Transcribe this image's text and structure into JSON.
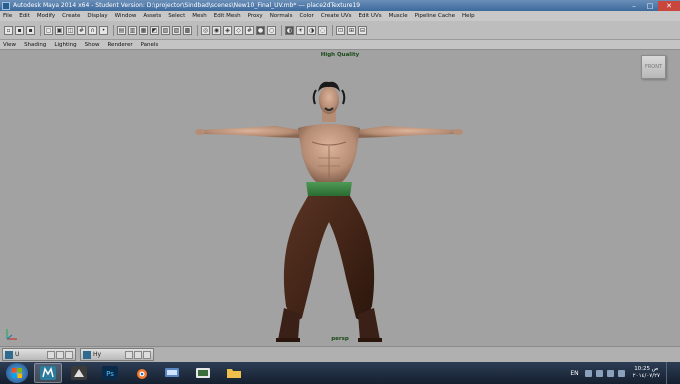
{
  "window": {
    "title": "Autodesk Maya 2014 x64 - Student Version: D:\\projector\\Sindbad\\scenes\\New10_Final_UV.mb*   ---   place2dTexture19",
    "min": "–",
    "max": "□",
    "close": "✕"
  },
  "menubar": {
    "items": [
      "File",
      "Edit",
      "Modify",
      "Create",
      "Display",
      "Window",
      "Assets",
      "Select",
      "Mesh",
      "Edit Mesh",
      "Proxy",
      "Normals",
      "Color",
      "Create UVs",
      "Edit UVs",
      "Muscle",
      "Pipeline Cache",
      "Help"
    ]
  },
  "panel_menu": {
    "items": [
      "View",
      "Shading",
      "Lighting",
      "Show",
      "Renderer",
      "Panels"
    ]
  },
  "viewport": {
    "quality_label": "High Quality",
    "camera_label": "persp",
    "viewcube_label": "FRONT"
  },
  "minimized_windows": [
    {
      "label": "U",
      "icon": "maya-window-icon"
    },
    {
      "label": "Hy",
      "icon": "hypershade-icon"
    }
  ],
  "taskbar": {
    "apps": [
      {
        "name": "start-button",
        "icon": "windows-logo-icon"
      },
      {
        "name": "maya",
        "icon": "maya-icon",
        "active": true
      },
      {
        "name": "mudbox",
        "icon": "mudbox-icon"
      },
      {
        "name": "photoshop",
        "icon": "photoshop-icon",
        "label": "Ps"
      },
      {
        "name": "blender",
        "icon": "blender-icon"
      },
      {
        "name": "network",
        "icon": "network-icon"
      },
      {
        "name": "media",
        "icon": "media-player-icon"
      },
      {
        "name": "explorer",
        "icon": "folder-icon"
      }
    ],
    "language": "EN",
    "time": "10:25 ص",
    "date": "٢٠١٤/٠٧/٢٧"
  }
}
